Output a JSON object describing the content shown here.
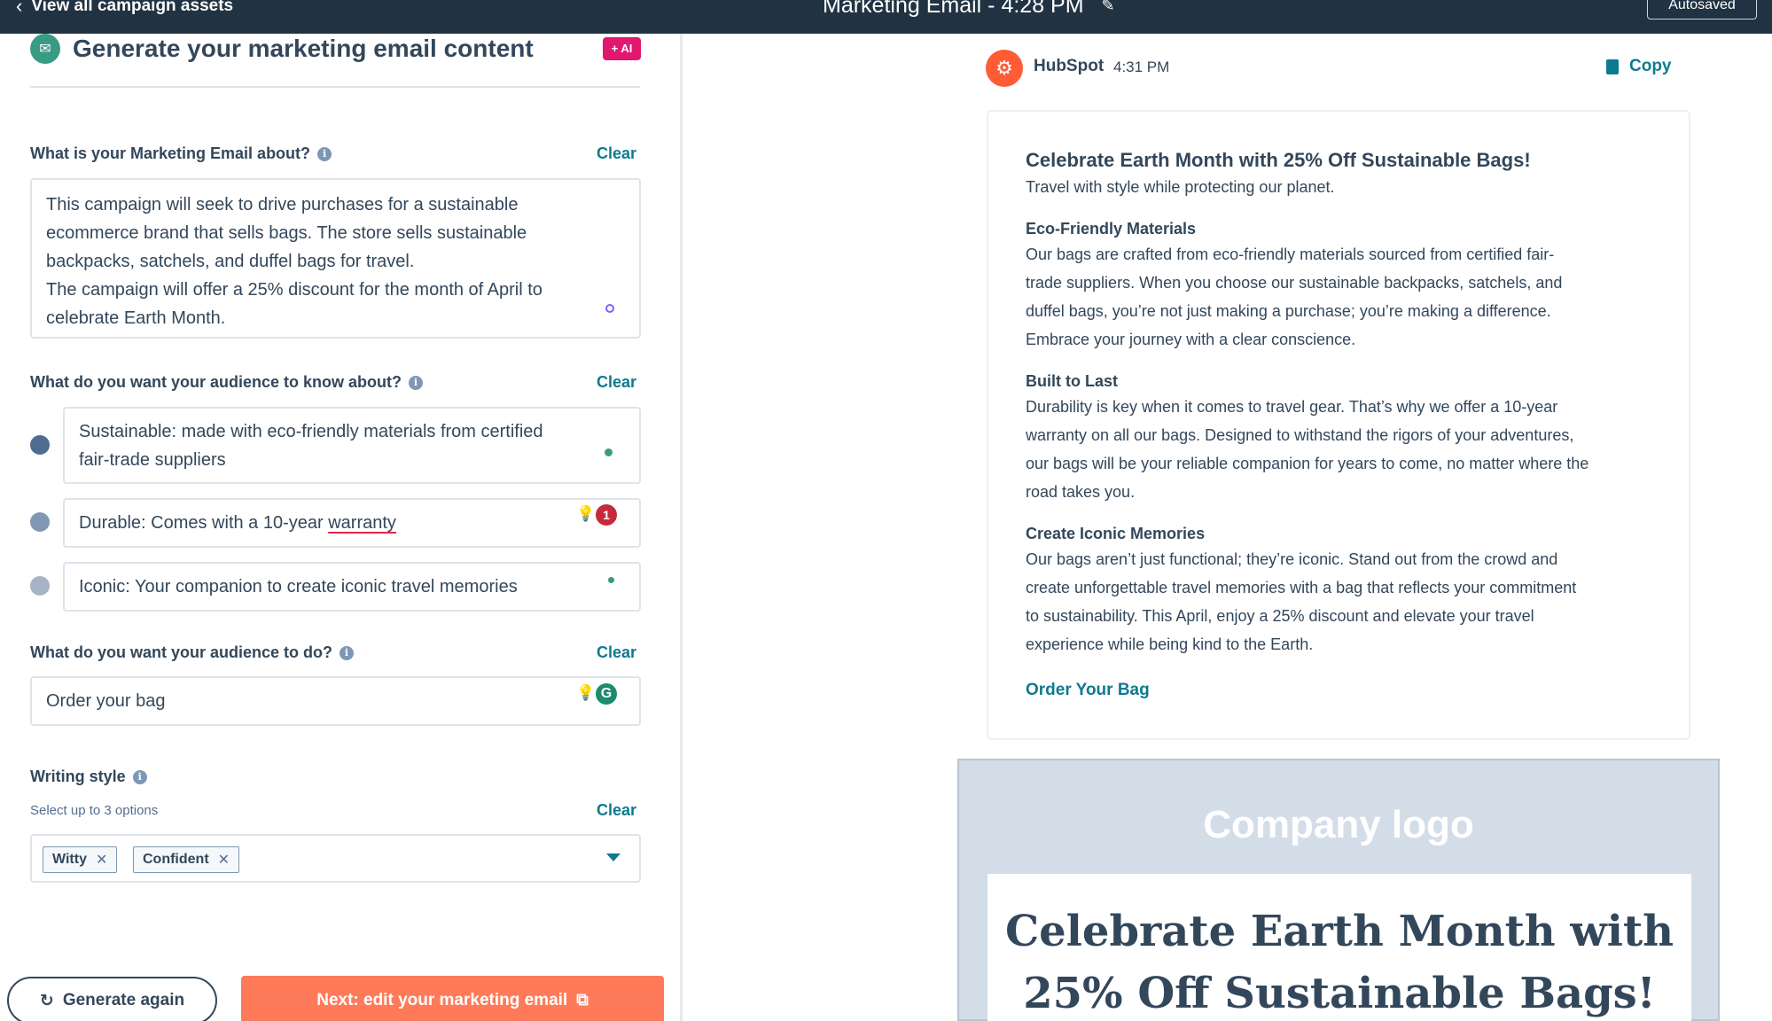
{
  "topbar": {
    "back_label": "View all campaign assets",
    "title": "Marketing Email - 4:28 PM",
    "autosaved": "Autosaved"
  },
  "left": {
    "heading": "Generate your marketing email content",
    "ai_badge": "+ AI",
    "clear_label": "Clear",
    "about": {
      "label": "What is your Marketing Email about?",
      "line1": "This campaign will seek to drive purchases for a sustainable",
      "line2": "ecommerce brand that sells bags. The store sells sustainable",
      "line3": "backpacks, satchels, and duffel bags for travel.",
      "line4": "The campaign will offer a 25% discount for the month of April to",
      "line5": "celebrate Earth Month."
    },
    "know": {
      "label": "What do you want your audience to know about?",
      "point1_line1": "Sustainable: made with eco-friendly materials from certified",
      "point1_line2": "fair-trade suppliers",
      "point2_prefix": "Durable: Comes with a 10-year ",
      "point2_underlined": "warranty",
      "point2_badge": "1",
      "point3": "Iconic: Your companion to create iconic travel memories"
    },
    "do": {
      "label": "What do you want your audience to do?",
      "value": "Order your bag"
    },
    "style": {
      "label": "Writing style",
      "sub": "Select up to 3 options",
      "tags": [
        "Witty",
        "Confident"
      ]
    },
    "generate_again": "Generate again",
    "next_button": "Next: edit your marketing email"
  },
  "right": {
    "sender": "HubSpot",
    "time": "4:31 PM",
    "copy_label": "Copy",
    "email": {
      "title": "Celebrate Earth Month with 25% Off Sustainable Bags!",
      "subtitle": "Travel with style while protecting our planet.",
      "s1_heading": "Eco-Friendly Materials",
      "s1_l1": "Our bags are crafted from eco-friendly materials sourced from certified fair-",
      "s1_l2": "trade suppliers. When you choose our sustainable backpacks, satchels, and",
      "s1_l3": "duffel bags, you’re not just making a purchase; you’re making a difference.",
      "s1_l4": "Embrace your journey with a clear conscience.",
      "s2_heading": "Built to Last",
      "s2_l1": "Durability is key when it comes to travel gear. That’s why we offer a 10-year",
      "s2_l2": "warranty on all our bags. Designed to withstand the rigors of your adventures,",
      "s2_l3": "our bags will be your reliable companion for years to come, no matter where the",
      "s2_l4": "road takes you.",
      "s3_heading": "Create Iconic Memories",
      "s3_l1": "Our bags aren’t just functional; they’re iconic. Stand out from the crowd and",
      "s3_l2": "create unforgettable travel memories with a bag that reflects your commitment",
      "s3_l3": "to sustainability. This April, enjoy a 25% discount and elevate your travel",
      "s3_l4": "experience while being kind to the Earth.",
      "cta": "Order Your Bag"
    },
    "preview": {
      "logo": "Company logo",
      "headline_l1": "Celebrate Earth Month with",
      "headline_l2": "25% Off Sustainable Bags!"
    }
  },
  "colors": {
    "topbar": "#213343",
    "accent_teal": "#0d7a8f",
    "cta_orange": "#ff7a59",
    "ai_pink": "#e2186f",
    "hubspot_orange": "#ff5c35"
  }
}
